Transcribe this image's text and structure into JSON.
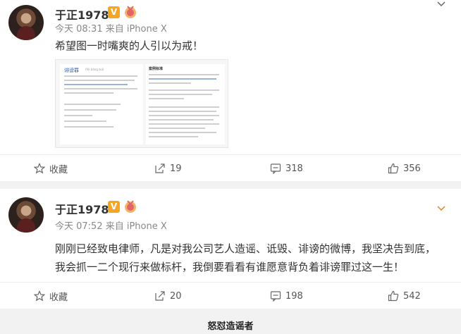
{
  "posts": [
    {
      "author": "于正1978",
      "verified_badge": "V",
      "meta": "今天 08:31 来自 iPhone X",
      "text": "希望图一时嘴爽的人引以为戒！",
      "actions": {
        "favorite": "收藏",
        "share": "19",
        "comment": "318",
        "like": "356"
      },
      "image": {
        "left_title": "诽谤罪",
        "left_pinyin": "(fěi bàng zuì)",
        "right_title": "案例标准"
      }
    },
    {
      "author": "于正1978",
      "verified_badge": "V",
      "meta": "今天 07:52 来自 iPhone X",
      "text": "刚刚已经致电律师，凡是对我公司艺人造谣、诋毁、诽谤的微博，我坚决告到底，我会抓一二个现行来做标杆，我倒要看看有谁愿意背负着诽谤罪过这一生！",
      "actions": {
        "favorite": "收藏",
        "share": "20",
        "comment": "198",
        "like": "542"
      }
    }
  ],
  "caption": "怒怼造谣者",
  "icons": [
    "avatar",
    "verified-icon",
    "medal-icon",
    "chevron-down-icon",
    "star-icon",
    "share-icon",
    "comment-icon",
    "like-icon"
  ],
  "colors": {
    "accent": "#f5a623",
    "text": "#333333",
    "meta": "#888888",
    "link": "#2a5db0"
  }
}
